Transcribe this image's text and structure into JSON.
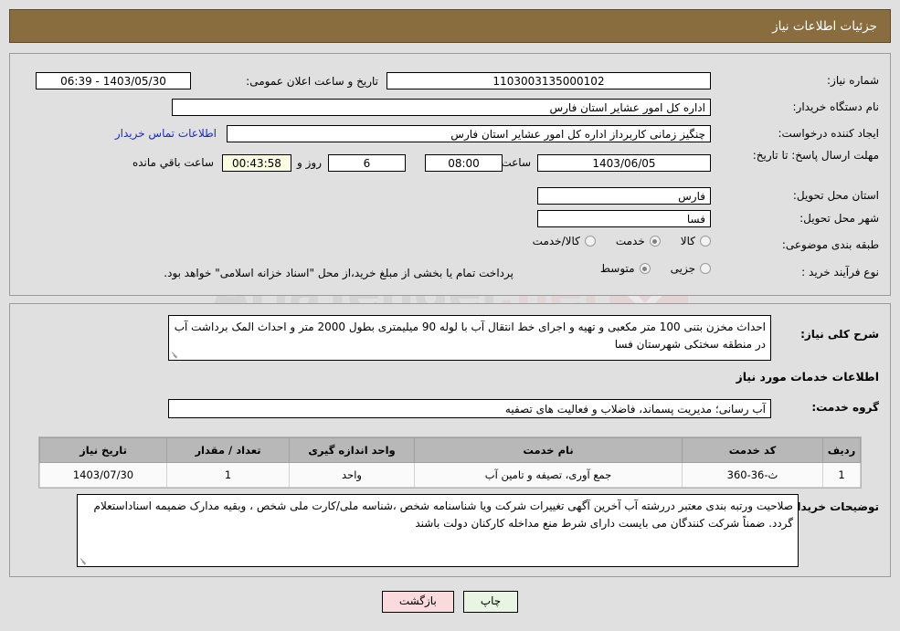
{
  "header": {
    "title": "جزئیات اطلاعات نیاز"
  },
  "watermark": {
    "text_main": "AriaTender",
    "text_accent": ".net",
    "icon": "shield-check-icon"
  },
  "need_info": {
    "need_number_label": "شماره نیاز:",
    "need_number_value": "1103003135000102",
    "announce_datetime_label": "تاریخ و ساعت اعلان عمومی:",
    "announce_datetime_value": "1403/05/30 - 06:39",
    "buyer_org_label": "نام دستگاه خریدار:",
    "buyer_org_value": "اداره کل امور عشایر استان فارس",
    "requester_label": "ایجاد کننده درخواست:",
    "requester_value": "چنگیز زمانی کاربرداز اداره کل امور عشایر استان فارس",
    "contact_link": "اطلاعات تماس خریدار",
    "deadline_label": "مهلت ارسال پاسخ: تا تاریخ:",
    "deadline_date": "1403/06/05",
    "hour_label": "ساعت",
    "deadline_time": "08:00",
    "days_remaining": "6",
    "days_label": "روز و",
    "countdown": "00:43:58",
    "countdown_label": "ساعت باقي مانده",
    "province_label": "استان محل تحویل:",
    "province_value": "فارس",
    "city_label": "شهر محل تحویل:",
    "city_value": "فسا",
    "category_label": "طبقه بندی موضوعی:",
    "category_options": [
      {
        "label": "کالا",
        "selected": false
      },
      {
        "label": "خدمت",
        "selected": true
      },
      {
        "label": "کالا/خدمت",
        "selected": false
      }
    ],
    "process_label": "نوع فرآیند خرید :",
    "process_options": [
      {
        "label": "جزیی",
        "selected": false
      },
      {
        "label": "متوسط",
        "selected": true
      }
    ],
    "process_note": "پرداخت تمام یا بخشی از مبلغ خرید،از محل \"اسناد خزانه اسلامی\" خواهد بود."
  },
  "description": {
    "label": "شرح کلی نیاز:",
    "value": "احداث مخزن بتنی 100 متر مکعبی و تهیه و اجرای خط انتقال آب با لوله 90 میلیمتری بطول 2000 متر و احداث المک برداشت آب در منطقه سختکی شهرستان فسا"
  },
  "services_section": {
    "heading": "اطلاعات خدمات مورد نیاز",
    "group_label": "گروه خدمت:",
    "group_value": "آب رسانی؛ مدیریت پسماند، فاضلاب و فعالیت های تصفیه"
  },
  "table": {
    "columns": [
      "ردیف",
      "کد خدمت",
      "نام خدمت",
      "واحد اندازه گیری",
      "تعداد / مقدار",
      "تاریخ نیاز"
    ],
    "rows": [
      {
        "row_no": "1",
        "service_code": "ث-36-360",
        "service_name": "جمع آوری، تصیفه و تامین آب",
        "unit": "واحد",
        "quantity": "1",
        "need_date": "1403/07/30"
      }
    ]
  },
  "buyer_notes": {
    "label": "توضیحات خریدار:",
    "value": "صلاحیت ورتبه بندی معتبر دررشته آب آخرین آگهی تغییرات شرکت ویا شناسنامه شخص ،شناسه ملی/کارت ملی شخص ، وبقیه مدارک  ضمیمه اسناداستعلام گردد. ضمناً شرکت کنندگان می بایست دارای شرط منع مداخله کارکنان دولت باشند"
  },
  "actions": {
    "print_label": "چاپ",
    "back_label": "بازگشت"
  }
}
